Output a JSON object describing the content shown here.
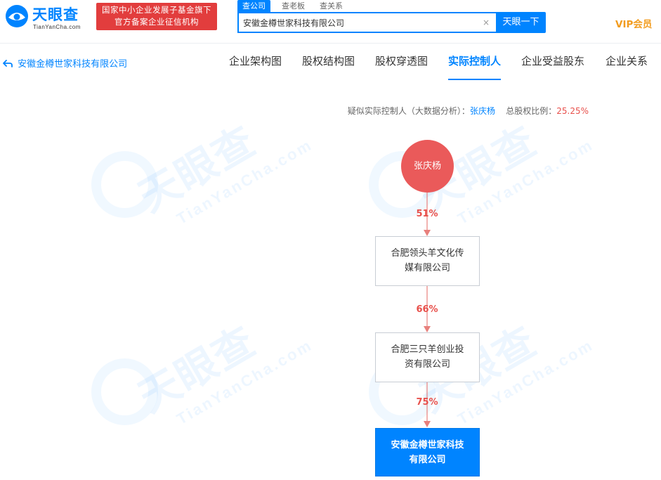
{
  "header": {
    "logo_text": "天眼查",
    "logo_sub": "TianYanCha.com",
    "gov_badge_line1": "国家中小企业发展子基金旗下",
    "gov_badge_line2": "官方备案企业征信机构",
    "search_tabs": [
      "查公司",
      "查老板",
      "查关系"
    ],
    "search_value": "安徽金樽世家科技有限公司",
    "clear_icon": "×",
    "search_button": "天眼一下",
    "vip": "VIP会员"
  },
  "nav": {
    "back_label": "安徽金樽世家科技有限公司",
    "tabs": [
      "企业架构图",
      "股权结构图",
      "股权穿透图",
      "实际控制人",
      "企业受益股东",
      "企业关系"
    ],
    "active_tab": "实际控制人"
  },
  "summary": {
    "prefix": "疑似实际控制人（大数据分析）：",
    "controller": "张庆杨",
    "ratio_label": "总股权比例：",
    "ratio": "25.25%"
  },
  "watermark": {
    "big": "天眼查",
    "small": "TianYanCha.com"
  },
  "chain": {
    "controller": "张庆杨",
    "edges": [
      "51%",
      "66%",
      "75%"
    ],
    "companies": [
      {
        "line1": "合肥领头羊文化传",
        "line2": "媒有限公司"
      },
      {
        "line1": "合肥三只羊创业投",
        "line2": "资有限公司"
      }
    ],
    "target": {
      "line1": "安徽金樽世家科技",
      "line2": "有限公司"
    }
  },
  "colors": {
    "brand": "#0084ff",
    "person": "#ea5a5a",
    "percent": "#e8504b",
    "gov_badge": "#e23d3d",
    "vip": "#f29c1f"
  }
}
